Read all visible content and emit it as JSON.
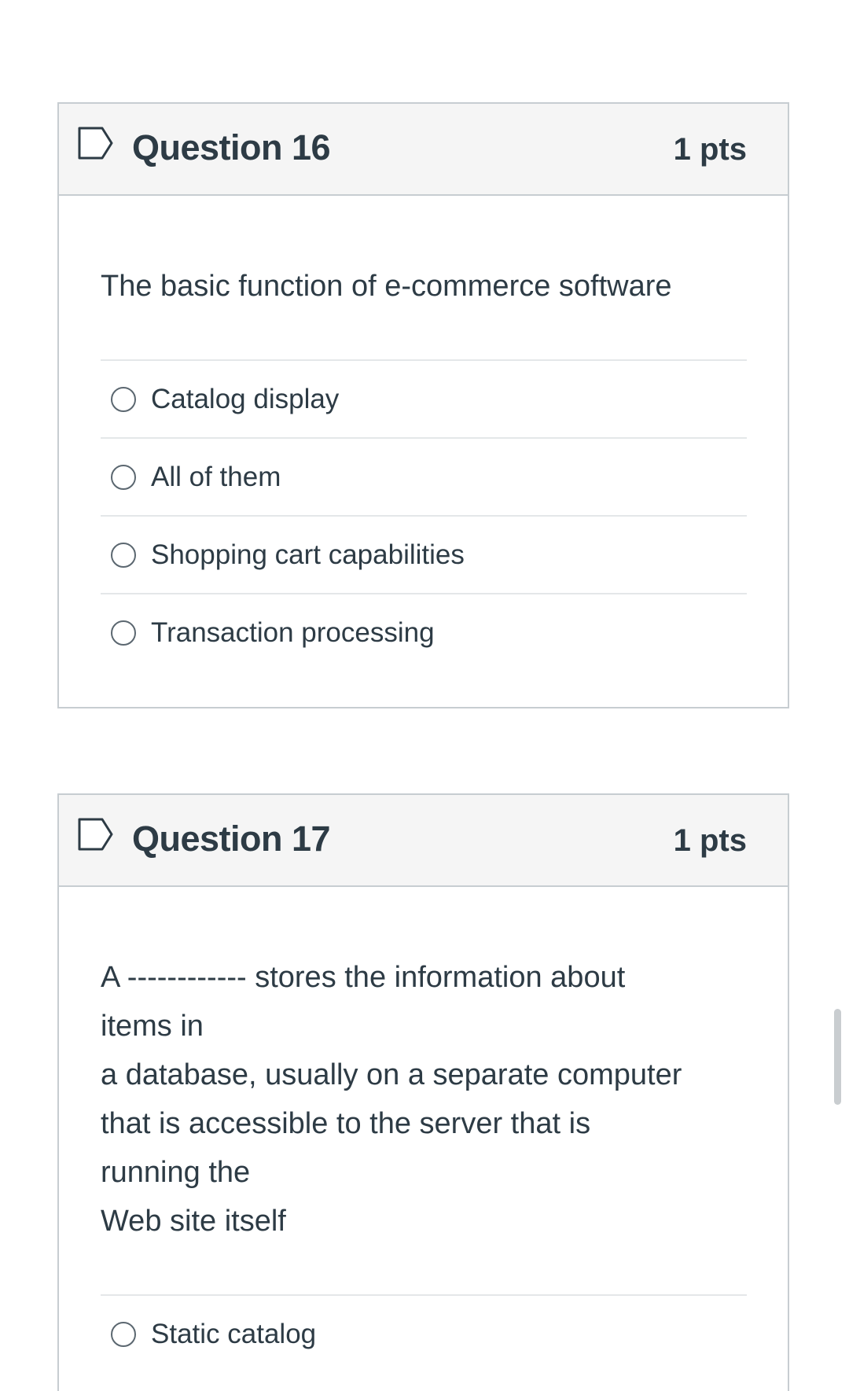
{
  "questions": [
    {
      "title": "Question 16",
      "points": "1 pts",
      "text_lines": [
        "The basic function of e-commerce software"
      ],
      "answers": [
        {
          "label": "Catalog display"
        },
        {
          "label": "All of them"
        },
        {
          "label": "Shopping cart capabilities"
        },
        {
          "label": "Transaction processing"
        }
      ]
    },
    {
      "title": "Question 17",
      "points": "1 pts",
      "text_lines": [
        "A ------------ stores the information about",
        "items in",
        "a database, usually on a separate computer",
        "that is accessible to the server that is",
        "running the",
        "Web site itself"
      ],
      "answers": [
        {
          "label": "Static catalog"
        }
      ]
    }
  ],
  "icons": {
    "flag": "bookmark-flag-icon",
    "radio": "radio-unchecked-icon"
  },
  "colors": {
    "text": "#2d3b45",
    "border": "#c7cdd1",
    "header_bg": "#f5f5f5",
    "divider": "#e4e7e9"
  }
}
